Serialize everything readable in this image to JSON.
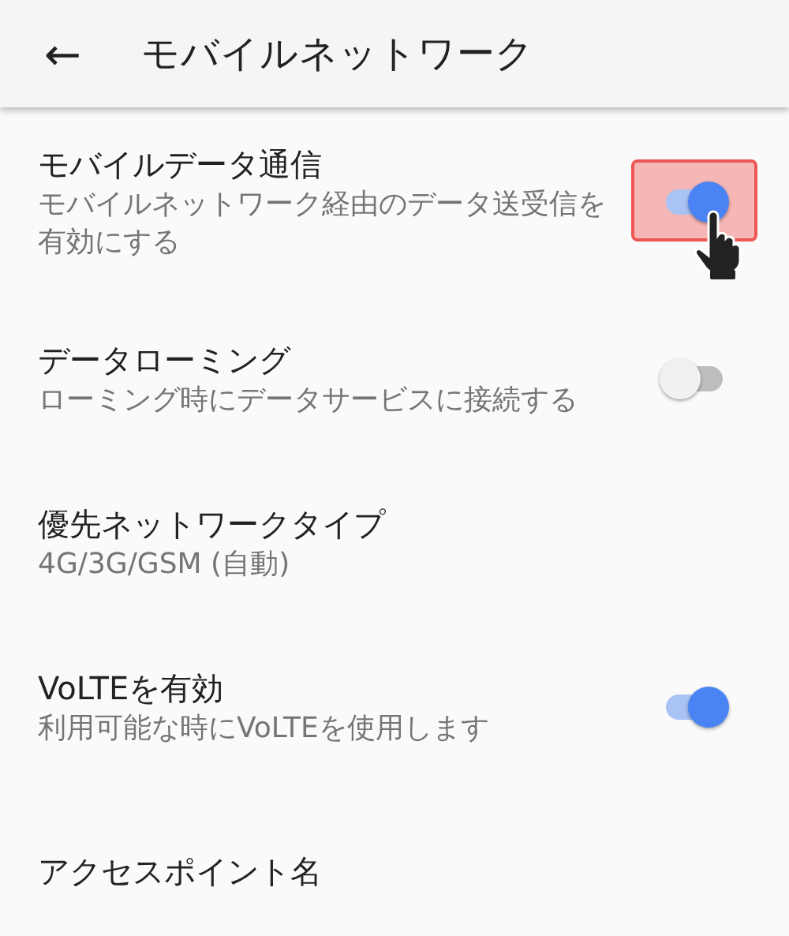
{
  "app_bar": {
    "back": "←",
    "title": "モバイルネットワーク"
  },
  "settings": [
    {
      "kind": "toggle",
      "title": "モバイルデータ通信",
      "summary": "モバイルネットワーク経由のデータ送受信を有効にする",
      "on": true,
      "highlighted": true
    },
    {
      "kind": "toggle",
      "title": "データローミング",
      "summary": "ローミング時にデータサービスに接続する",
      "on": false,
      "highlighted": false
    },
    {
      "kind": "plain",
      "title": "優先ネットワークタイプ",
      "summary": "4G/3G/GSM (自動)"
    },
    {
      "kind": "toggle",
      "title": "VoLTEを有効",
      "summary": "利用可能な時にVoLTEを使用します",
      "on": true,
      "highlighted": false
    },
    {
      "kind": "plain",
      "title": "アクセスポイント名"
    }
  ]
}
